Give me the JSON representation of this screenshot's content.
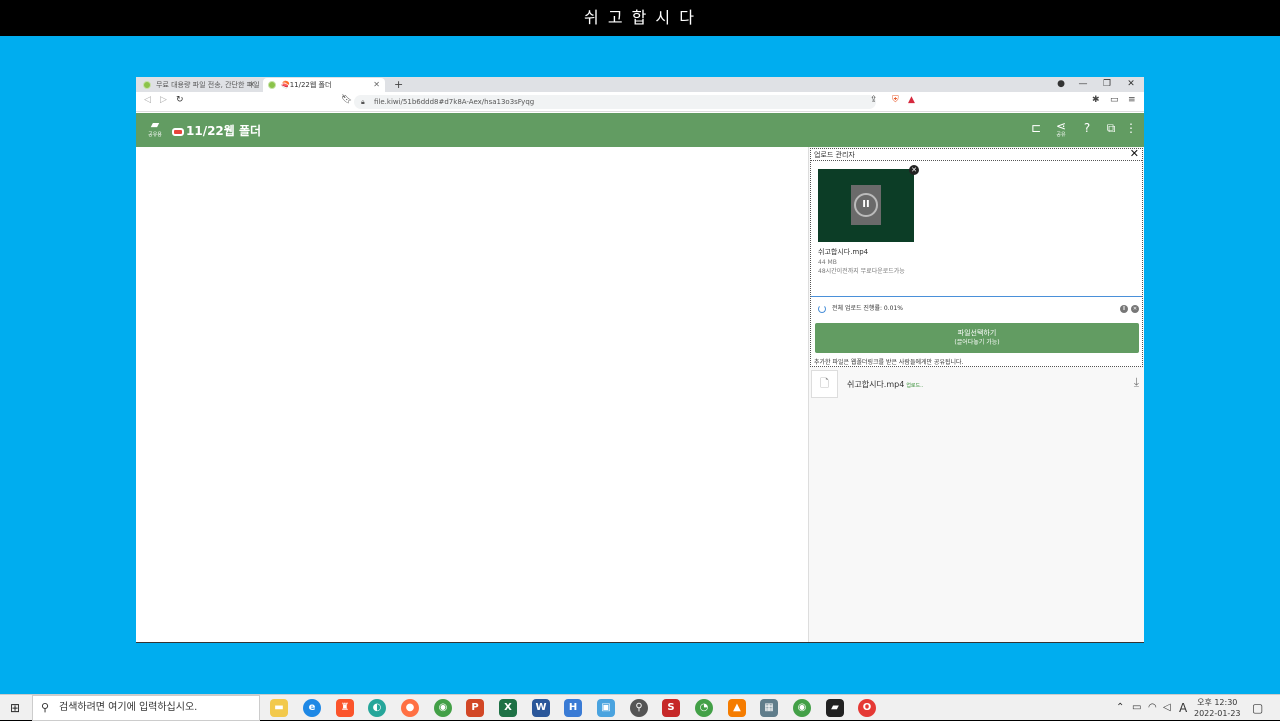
{
  "overlay_title": "쉬 고 합 시 다",
  "browser": {
    "tabs": [
      {
        "title": "무료 대용량 파일 전송, 간단한 파일"
      },
      {
        "title": "🍣11/22웹 폴더"
      }
    ],
    "url": "file.kiwi/51b6ddd8#d7k8A-Aex/hsa13o3sFyqg"
  },
  "app": {
    "folder_label": "공유용",
    "title": "11/22웹 폴더",
    "share_label": "공유"
  },
  "upload_manager": {
    "title": "업로드 관리자",
    "item": {
      "file_name": "쉬고합시다.mp4",
      "size": "44 MB",
      "note": "48시간이전까지 무료다운로드가능"
    },
    "progress_text": "전체 업로드 진행률: 0.01%",
    "select_button": "파일선택하기",
    "select_button_sub": "(끌어다놓기 가능)",
    "share_note": "추가한 파일은 웹폴더링크를 받은 사람들에게만 공유됩니다."
  },
  "file_list": [
    {
      "name": "쉬고합시다.mp4",
      "status": "업로드.."
    }
  ],
  "taskbar": {
    "search_placeholder": "검색하려면 여기에 입력하십시오.",
    "clock_time": "오후 12:30",
    "clock_date": "2022-01-23",
    "ime": "A"
  }
}
